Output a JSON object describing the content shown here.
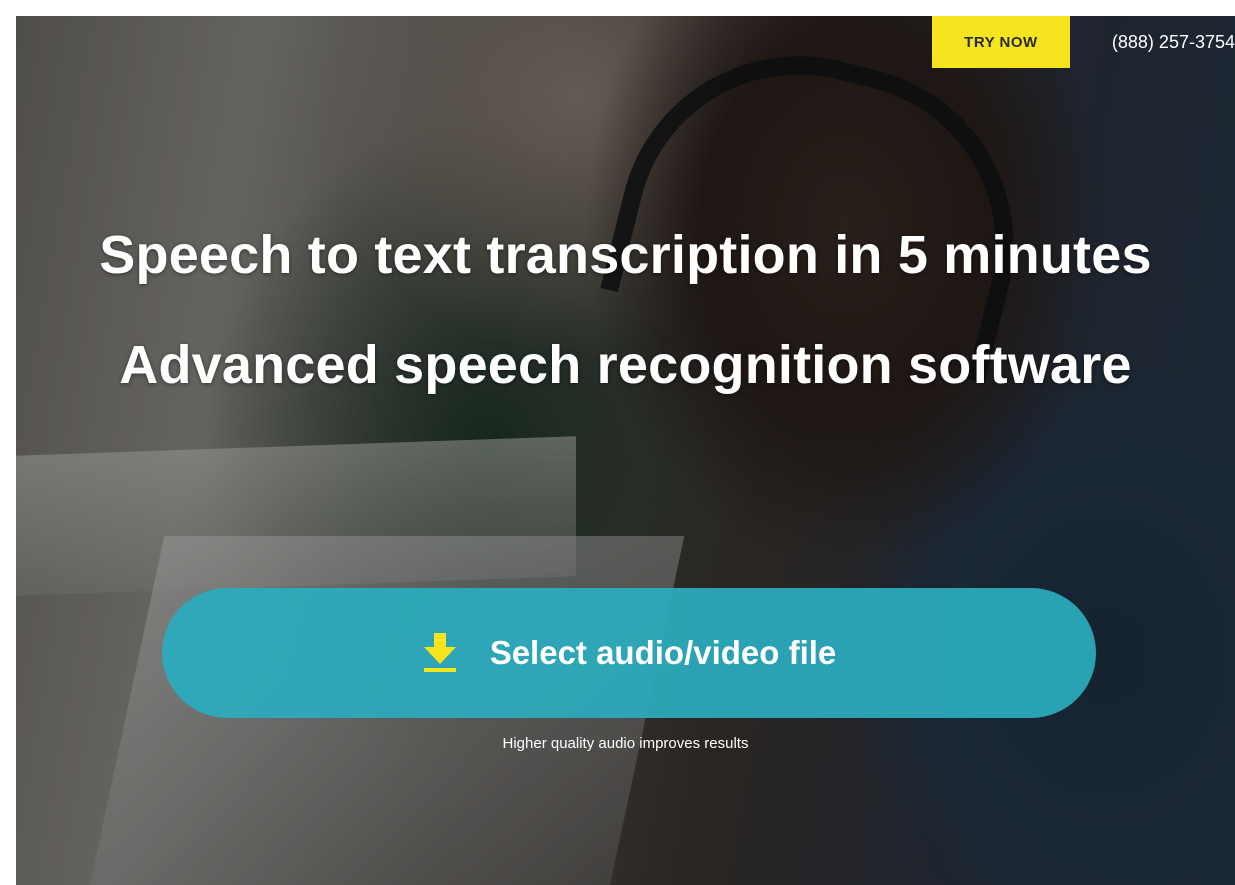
{
  "header": {
    "cta_label": "TRY NOW",
    "phone": "(888) 257-3754"
  },
  "hero": {
    "headline_1": "Speech to text transcription in 5 minutes",
    "headline_2": "Advanced speech recognition software",
    "upload_label": "Select audio/video file",
    "upload_icon": "download-icon",
    "hint": "Higher quality audio improves results"
  },
  "colors": {
    "cta_bg": "#f6e41e",
    "upload_bg": "#2bacbe",
    "icon_color": "#f6e41e",
    "text": "#ffffff"
  }
}
